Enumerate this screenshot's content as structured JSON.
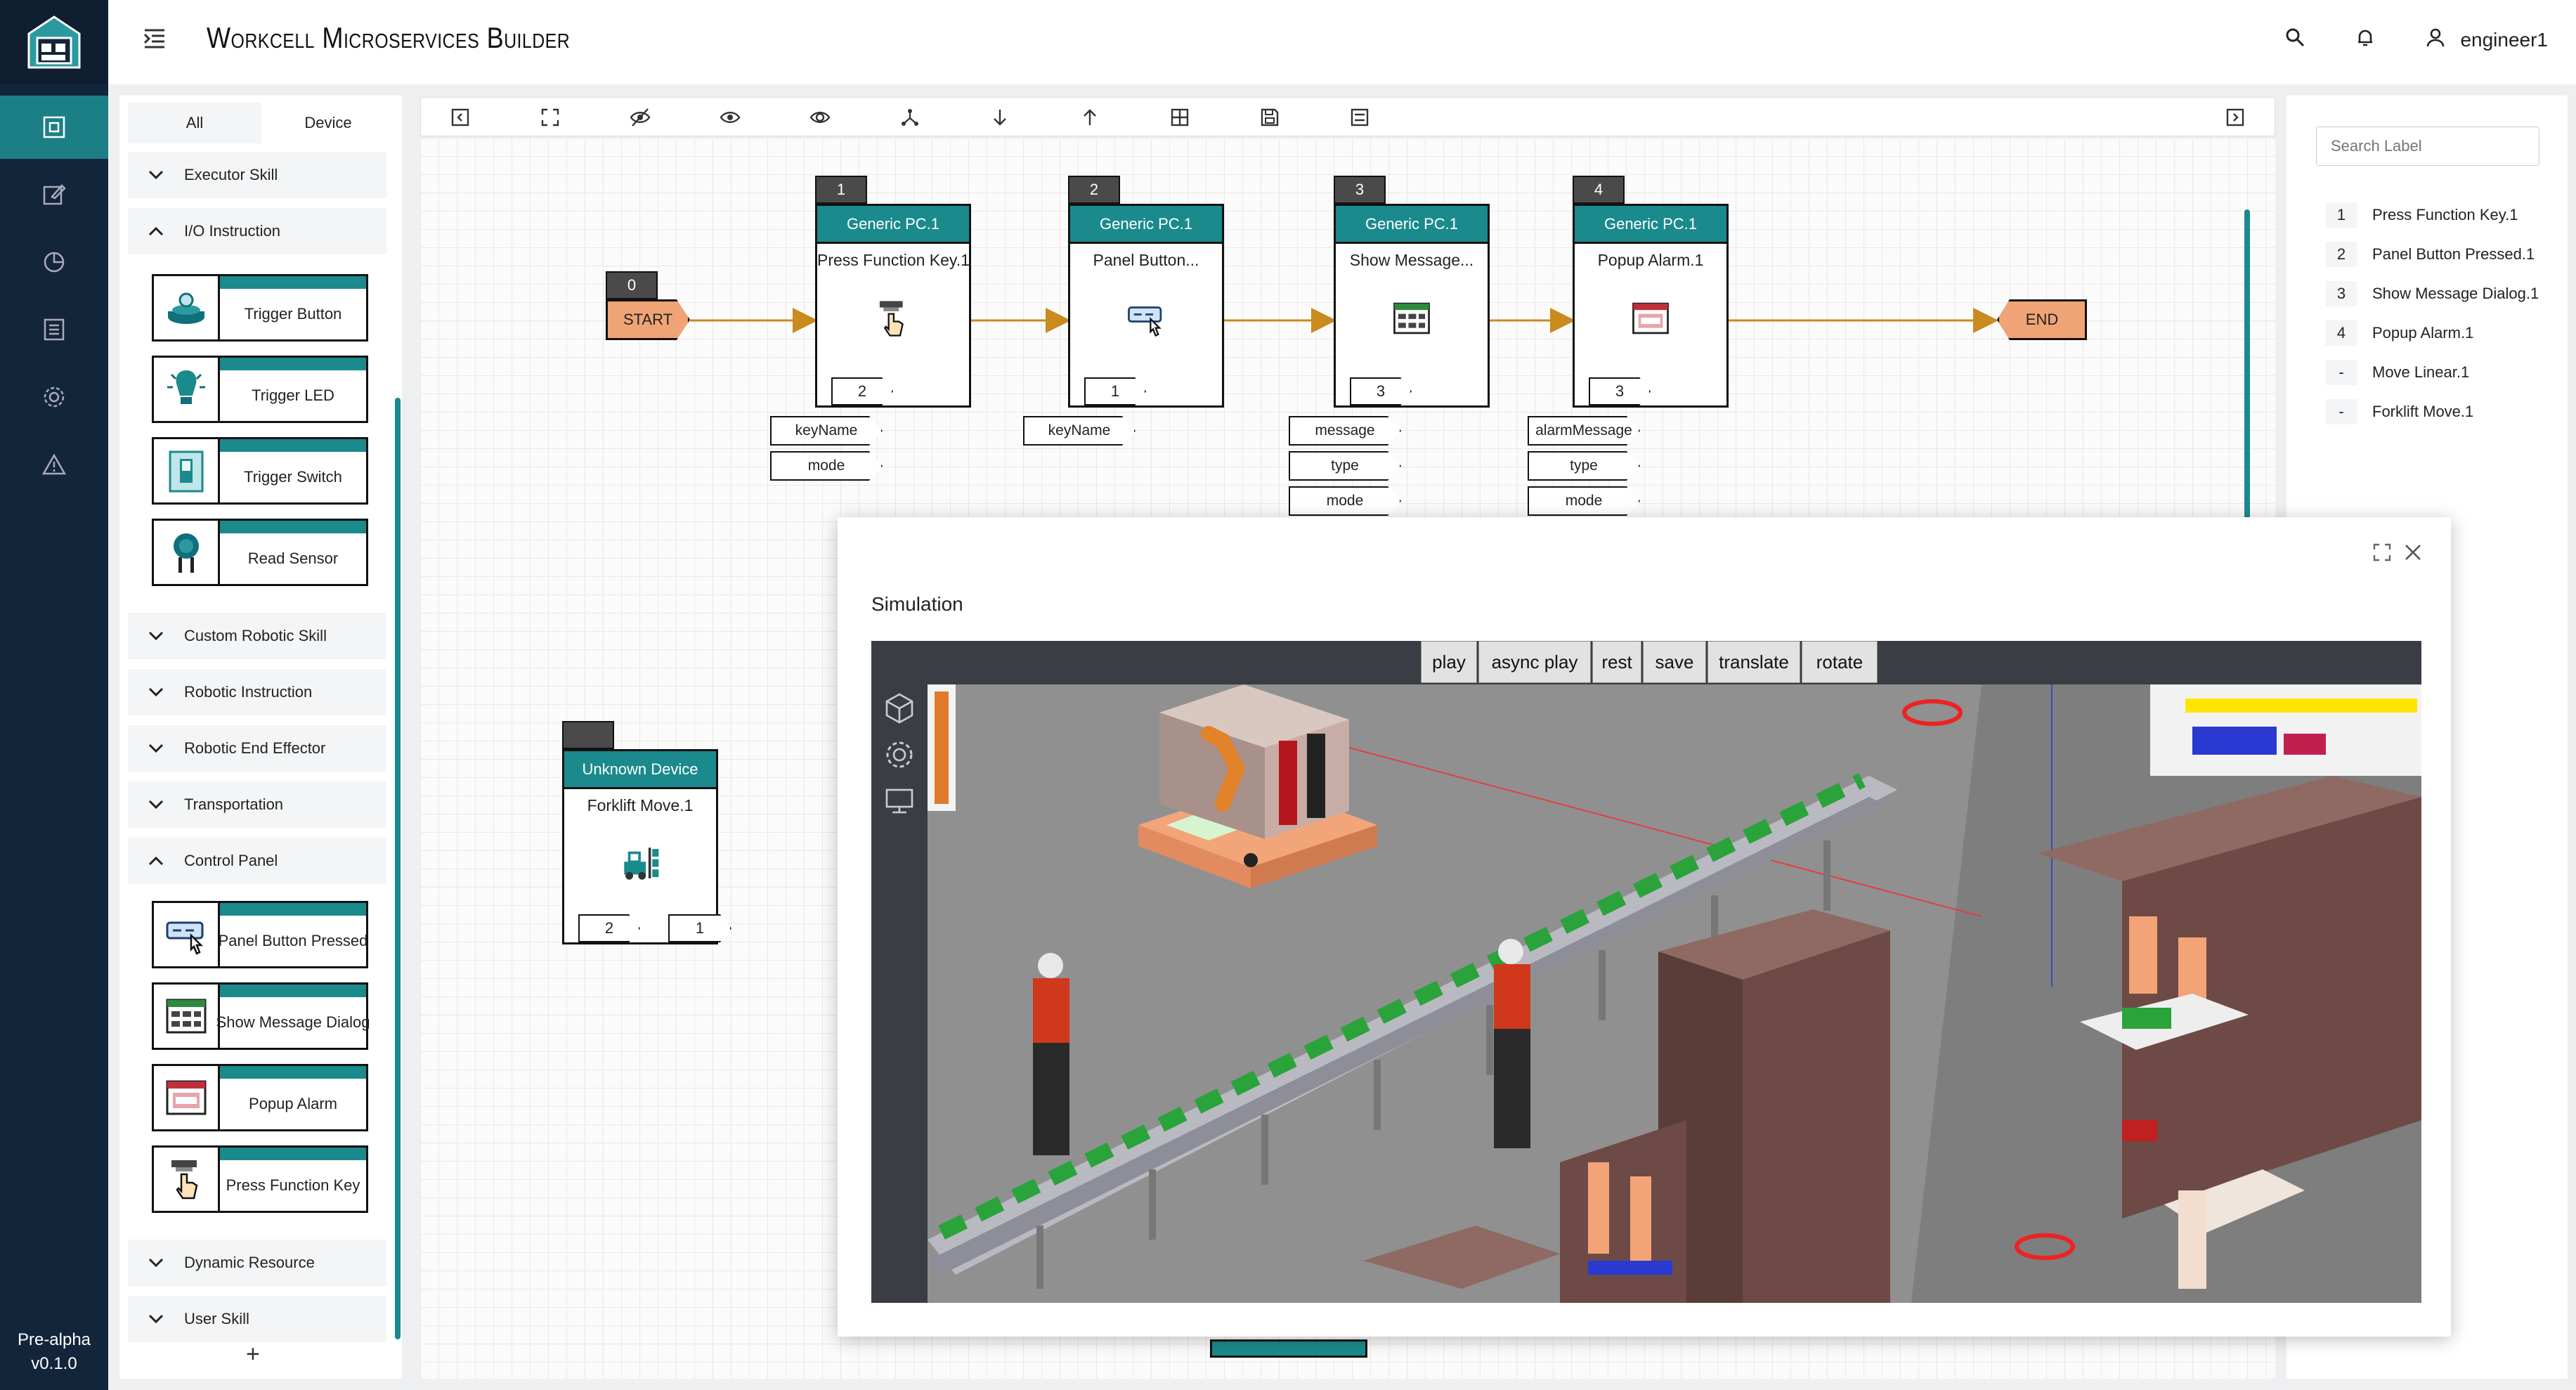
{
  "app": {
    "title": "Workcell Microservices Builder",
    "version_stage": "Pre-alpha",
    "version": "v0.1.0",
    "user": "engineer1"
  },
  "rail": {
    "items": [
      "dashboard-icon",
      "edit-icon",
      "chart-icon",
      "list-icon",
      "gear-icon",
      "warning-icon"
    ]
  },
  "library": {
    "tabs": [
      "All",
      "Device"
    ],
    "categories": [
      {
        "label": "Executor Skill",
        "expanded": false
      },
      {
        "label": "I/O Instruction",
        "expanded": true,
        "items": [
          "Trigger Button",
          "Trigger LED",
          "Trigger Switch",
          "Read Sensor"
        ]
      },
      {
        "label": "Custom Robotic Skill",
        "expanded": false
      },
      {
        "label": "Robotic Instruction",
        "expanded": false
      },
      {
        "label": "Robotic End Effector",
        "expanded": false
      },
      {
        "label": "Transportation",
        "expanded": false
      },
      {
        "label": "Control Panel",
        "expanded": true,
        "items": [
          "Panel Button Pressed",
          "Show Message Dialog",
          "Popup Alarm",
          "Press Function Key"
        ]
      },
      {
        "label": "Dynamic Resource",
        "expanded": false
      },
      {
        "label": "User Skill",
        "expanded": false
      }
    ],
    "add_label": "+"
  },
  "flow": {
    "start": {
      "index": "0",
      "label": "START"
    },
    "end": {
      "label": "END"
    },
    "nodes": [
      {
        "index": "1",
        "device": "Generic PC.1",
        "name": "Press Function Key.1",
        "in": "2",
        "params": [
          "keyName",
          "mode"
        ]
      },
      {
        "index": "2",
        "device": "Generic PC.1",
        "name": "Panel Button...",
        "in": "1",
        "params": [
          "keyName"
        ]
      },
      {
        "index": "3",
        "device": "Generic PC.1",
        "name": "Show Message...",
        "in": "3",
        "params": [
          "message",
          "type",
          "mode"
        ]
      },
      {
        "index": "4",
        "device": "Generic PC.1",
        "name": "Popup Alarm.1",
        "in": "3",
        "params": [
          "alarmMessage",
          "type",
          "mode"
        ]
      }
    ],
    "orphan": {
      "device": "Unknown Device",
      "name": "Forklift Move.1",
      "in": "2",
      "out": "1"
    }
  },
  "labels": {
    "search_placeholder": "Search Label",
    "items": [
      {
        "n": "1",
        "label": "Press Function Key.1"
      },
      {
        "n": "2",
        "label": "Panel Button Pressed.1"
      },
      {
        "n": "3",
        "label": "Show Message Dialog.1"
      },
      {
        "n": "4",
        "label": "Popup Alarm.1"
      },
      {
        "n": "-",
        "label": "Move Linear.1"
      },
      {
        "n": "-",
        "label": "Forklift Move.1"
      }
    ]
  },
  "simulation": {
    "title": "Simulation",
    "buttons": [
      "play",
      "async play",
      "rest",
      "save",
      "translate",
      "rotate"
    ]
  },
  "colors": {
    "accent": "#1b8a8c",
    "rail": "#13253a",
    "terminal": "#f0a476",
    "link": "#c98a1e"
  }
}
